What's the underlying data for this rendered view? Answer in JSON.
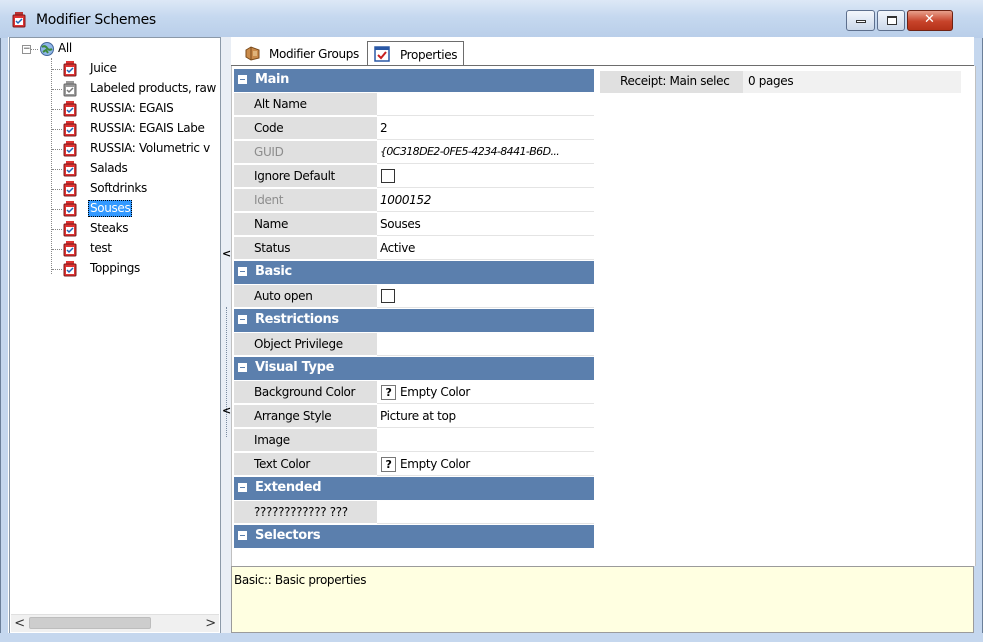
{
  "window": {
    "title": "Modifier Schemes",
    "controls": [
      "minimize",
      "maximize",
      "close"
    ],
    "min_symbol": "▭",
    "max_symbol": "▫",
    "close_symbol": "✕"
  },
  "tree": {
    "root": {
      "label": "All",
      "expander": "−"
    },
    "items": [
      {
        "label": "Juice",
        "disabled": false,
        "selected": false
      },
      {
        "label": "Labeled products, raw",
        "disabled": true,
        "selected": false
      },
      {
        "label": "RUSSIA: EGAIS",
        "disabled": false,
        "selected": false
      },
      {
        "label": "RUSSIA: EGAIS Labe",
        "disabled": false,
        "selected": false
      },
      {
        "label": "RUSSIA: Volumetric v",
        "disabled": false,
        "selected": false
      },
      {
        "label": "Salads",
        "disabled": false,
        "selected": false
      },
      {
        "label": "Softdrinks",
        "disabled": false,
        "selected": false
      },
      {
        "label": "Souses",
        "disabled": false,
        "selected": true
      },
      {
        "label": "Steaks",
        "disabled": false,
        "selected": false
      },
      {
        "label": "test",
        "disabled": false,
        "selected": false
      },
      {
        "label": "Toppings",
        "disabled": false,
        "selected": false
      }
    ],
    "scroll_left": "<",
    "scroll_right": ">"
  },
  "splitter": {
    "collapse_top": "<",
    "collapse_mid": "<"
  },
  "tabs": [
    {
      "label": "Modifier Groups",
      "active": false,
      "icon": "modifier-groups-icon"
    },
    {
      "label": "Properties",
      "active": true,
      "icon": "properties-icon"
    }
  ],
  "properties": {
    "categories": {
      "main": "Main",
      "basic": "Basic",
      "restrictions": "Restrictions",
      "visual_type": "Visual Type",
      "extended": "Extended",
      "selectors": "Selectors"
    },
    "rows": {
      "alt_name": {
        "name": "Alt Name",
        "value": ""
      },
      "code": {
        "name": "Code",
        "value": "2"
      },
      "guid": {
        "name": "GUID",
        "value": "{0C318DE2-0FE5-4234-8441-B6D..."
      },
      "ignore_default": {
        "name": "Ignore Default",
        "checked": false
      },
      "ident": {
        "name": "Ident",
        "value": "1000152"
      },
      "name": {
        "name": "Name",
        "value": "Souses"
      },
      "status": {
        "name": "Status",
        "value": "Active"
      },
      "auto_open": {
        "name": "Auto open",
        "checked": false
      },
      "object_privilege": {
        "name": "Object Privilege",
        "value": ""
      },
      "background_color": {
        "name": "Background Color",
        "value": "Empty Color",
        "qmark": "?"
      },
      "arrange_style": {
        "name": "Arrange Style",
        "value": "Picture at top"
      },
      "image": {
        "name": "Image",
        "value": ""
      },
      "text_color": {
        "name": "Text Color",
        "value": "Empty Color",
        "qmark": "?"
      },
      "unknown": {
        "name": "???????????? ???",
        "value": ""
      }
    }
  },
  "side_info": {
    "name": "Receipt: Main selec",
    "value": "0 pages"
  },
  "description": {
    "text": "Basic:: Basic properties"
  },
  "colors": {
    "category_header": "#5b7fad",
    "selection": "#3399ff",
    "description_bg": "#ffffe1",
    "title_bar": "#c5d8ef"
  }
}
